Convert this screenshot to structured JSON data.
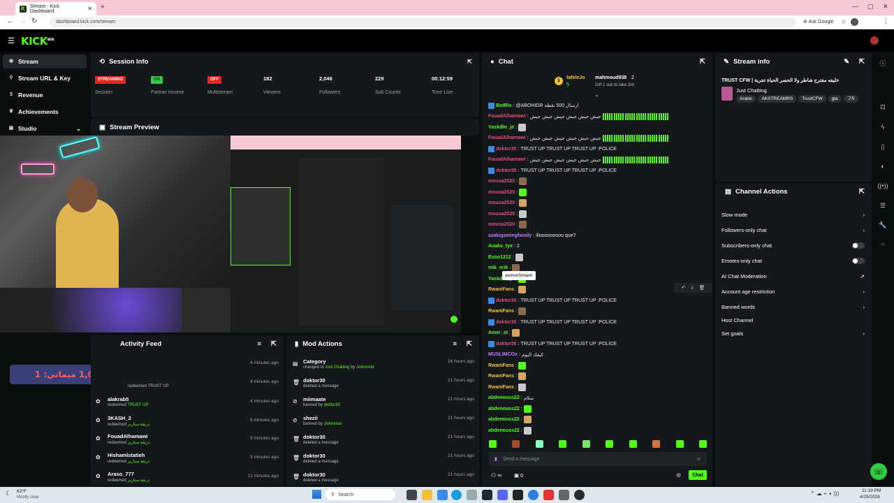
{
  "browser": {
    "tab_title": "Stream - Kick Dashboard",
    "url": "dashboard.kick.com/stream",
    "ask_google": "Ask Google"
  },
  "app": {
    "logo": "KICK",
    "logo_sup": "BETA"
  },
  "sidebar": {
    "items": [
      {
        "label": "Stream",
        "icon": "broadcast-icon"
      },
      {
        "label": "Stream URL & Key",
        "icon": "link-icon"
      },
      {
        "label": "Revenue",
        "icon": "dollar-icon"
      },
      {
        "label": "Achievements",
        "icon": "trophy-icon"
      },
      {
        "label": "Studio",
        "icon": "studio-icon"
      }
    ]
  },
  "session": {
    "title": "Session Info",
    "stats": [
      {
        "value": "STREAMING",
        "label": "Session",
        "kind": "badge-red"
      },
      {
        "value": "ON",
        "label": "Partner income",
        "kind": "badge-green"
      },
      {
        "value": "OFF",
        "label": "Multistream",
        "kind": "badge-red"
      },
      {
        "value": "182",
        "label": "Viewers"
      },
      {
        "value": "2,046",
        "label": "Followers"
      },
      {
        "value": "229",
        "label": "Sub Counts"
      },
      {
        "value": "00:12:59",
        "label": "Time Live"
      }
    ]
  },
  "preview": {
    "title": "Stream Preview",
    "overlay_text": "المكافأة: 1,000 ميماتي: 1C"
  },
  "activity": {
    "title": "Activity Feed",
    "rows": [
      {
        "user": "",
        "text": "",
        "time": "4 minutes ago"
      },
      {
        "user": "",
        "text": "redeemed TRUST UP",
        "time": "4 minutes ago"
      },
      {
        "user": "alakrab5",
        "pre": "redeemed",
        "item": "TRUST UP",
        "time": "4 minutes ago"
      },
      {
        "user": "3KASH_2",
        "pre": "redeemed",
        "item": "درنقة ستاريز",
        "time": "6 minutes ago"
      },
      {
        "user": "FouadAlhamawi",
        "pre": "redeemed",
        "item": "درنقة ستاريز",
        "time": "9 minutes ago"
      },
      {
        "user": "Hishamlstatieh",
        "pre": "redeemed",
        "item": "درنقة ستاريز",
        "time": "9 minutes ago"
      },
      {
        "user": "Araso_777",
        "pre": "redeemed",
        "item": "درنقة ستاريز",
        "time": "11 minutes ago"
      }
    ]
  },
  "mod": {
    "title": "Mod Actions",
    "rows": [
      {
        "user": "Category",
        "text": "changed to",
        "hl": "Just Chatting",
        "by": "by",
        "mod": "JoAmmar",
        "time": "16 hours ago",
        "icon": "folder-icon"
      },
      {
        "user": "doktor30",
        "text": "deleted a message",
        "time": "21 hours ago",
        "icon": "trash-icon"
      },
      {
        "user": "miimaate",
        "text": "banned by",
        "mod": "doktor30",
        "time": "21 hours ago",
        "icon": "ban-icon"
      },
      {
        "user": "shezii",
        "text": "banned by",
        "mod": "JoAmmar",
        "time": "21 hours ago",
        "icon": "ban-icon"
      },
      {
        "user": "doktor30",
        "text": "deleted a message",
        "time": "21 hours ago",
        "icon": "trash-icon"
      },
      {
        "user": "doktor30",
        "text": "deleted a message",
        "time": "21 hours ago",
        "icon": "trash-icon"
      },
      {
        "user": "doktor30",
        "text": "deleted a message",
        "time": "21 hours ago",
        "icon": "trash-icon"
      }
    ]
  },
  "chat": {
    "title": "Chat",
    "pinned": {
      "user1": "tafeleJo",
      "user2": "mahmoud938",
      "count": "2",
      "sub": "5",
      "gift": "Gift 1 sub to take 3rd"
    },
    "lines": [
      {
        "user": "BotRix",
        "color": "#53fc18",
        "msg": "@ABOHIDR ارسال 500 نقطة",
        "bot": true
      },
      {
        "user": "FouadAlhamawi",
        "color": "#e04e7a",
        "msg": "جيش جيش جيش جيش جيش جيش",
        "bars": true
      },
      {
        "user": "Yaskdhr_je",
        "color": "#53fc18",
        "msg": "",
        "emote": true
      },
      {
        "user": "FouadAlhamawi",
        "color": "#e04e7a",
        "msg": "جيش جيش جيش جيش جيش جيش",
        "bars": true
      },
      {
        "user": "doktor30",
        "color": "#e04e7a",
        "msg": "TRUST UP  TRUST UP  TRUST UP  :POLICE",
        "bot": true
      },
      {
        "user": "FouadAlhamawi",
        "color": "#e04e7a",
        "msg": "جيش جيش جيش جيش جيش جيش",
        "bars": true
      },
      {
        "user": "doktor30",
        "color": "#e04e7a",
        "msg": "TRUST UP  TRUST UP  TRUST UP  :POLICE",
        "bot": true
      },
      {
        "user": "mousa2020",
        "color": "#e04e7a",
        "msg": "",
        "emote": true
      },
      {
        "user": "mousa2020",
        "color": "#e04e7a",
        "msg": "",
        "emote": true
      },
      {
        "user": "mousa2020",
        "color": "#e04e7a",
        "msg": "",
        "emote": true
      },
      {
        "user": "mousa2020",
        "color": "#e04e7a",
        "msg": "",
        "emote": true
      },
      {
        "user": "mousa2020",
        "color": "#e04e7a",
        "msg": "",
        "emote": true
      },
      {
        "user": "azakigamingfamily",
        "color": "#c47bff",
        "msg": "illooooooooo que?"
      },
      {
        "user": "Auaks_tye",
        "color": "#53fc18",
        "msg": "2"
      },
      {
        "user": "Esoo1212",
        "color": "#53fc18",
        "msg": "",
        "emote": true
      },
      {
        "user": "mik_erik",
        "color": "#53fc18",
        "msg": "",
        "emote": true
      },
      {
        "user": "Yaskdhr_je",
        "color": "#53fc18",
        "msg": "",
        "emote": true
      },
      {
        "user": "RwaniFans",
        "color": "#f3c03a",
        "msg": "",
        "emote": true
      },
      {
        "user": "doktor30",
        "color": "#e04e7a",
        "msg": "TRUST UP  TRUST UP  TRUST UP  :POLICE",
        "bot": true
      },
      {
        "user": "RwaniFans",
        "color": "#f3c03a",
        "msg": "",
        "emote": true
      },
      {
        "user": "doktor30",
        "color": "#e04e7a",
        "msg": "TRUST UP  TRUST UP  TRUST UP  :POLICE",
        "bot": true
      },
      {
        "user": "Amer_st",
        "color": "#53fc18",
        "msg": "",
        "emote": true
      },
      {
        "user": "doktor30",
        "color": "#e04e7a",
        "msg": "TRUST UP  TRUST UP  TRUST UP  :POLICE",
        "bot": true
      },
      {
        "user": "MUSLIMCOx",
        "color": "#c47bff",
        "msg": "كيفك اليوم"
      },
      {
        "user": "RwaniFans",
        "color": "#f3c03a",
        "msg": "",
        "emote": true
      },
      {
        "user": "RwaniFans",
        "color": "#f3c03a",
        "msg": "",
        "emote": true
      },
      {
        "user": "RwaniFans",
        "color": "#f3c03a",
        "msg": "",
        "emote": true
      },
      {
        "user": "abdenouss22",
        "color": "#53fc18",
        "msg": "سلام"
      },
      {
        "user": "abdenouss22",
        "color": "#53fc18",
        "msg": "",
        "emote": true
      },
      {
        "user": "abdenouss22",
        "color": "#53fc18",
        "msg": "",
        "emote": true
      },
      {
        "user": "abdenouss22",
        "color": "#53fc18",
        "msg": "",
        "emote": true
      }
    ],
    "tooltip": "asmonSmash",
    "input_placeholder": "Send a message",
    "send_label": "Chat",
    "points": "0"
  },
  "stream_info": {
    "title": "Stream info",
    "stream_title": "TRUST CFW | خليفه مفترح شاطر ولا الحصر الحياة تجربة",
    "category": "Just Chatting",
    "tags": [
      "Arabic",
      "AKSTREAMRS",
      "TrustCFW",
      "gta",
      "フR"
    ]
  },
  "actions": {
    "title": "Channel Actions",
    "items": [
      {
        "label": "Slow mode",
        "ctrl": "chevron"
      },
      {
        "label": "Followers-only chat",
        "ctrl": "chevron"
      },
      {
        "label": "Subscribers-only chat",
        "ctrl": "toggle"
      },
      {
        "label": "Emotes-only chat",
        "ctrl": "toggle"
      },
      {
        "label": "AI Chat Moderation",
        "ctrl": "external"
      },
      {
        "label": "Account age restriction",
        "ctrl": "chevron"
      },
      {
        "label": "Banned words",
        "ctrl": "chevron"
      },
      {
        "label": "Host Channel",
        "ctrl": "none"
      },
      {
        "label": "Set goals",
        "ctrl": "chevron"
      }
    ]
  },
  "taskbar": {
    "weather_temp": "63°F",
    "weather_desc": "Mostly clear",
    "search": "Search",
    "time": "11:19 PM",
    "date": "4/29/2026"
  }
}
